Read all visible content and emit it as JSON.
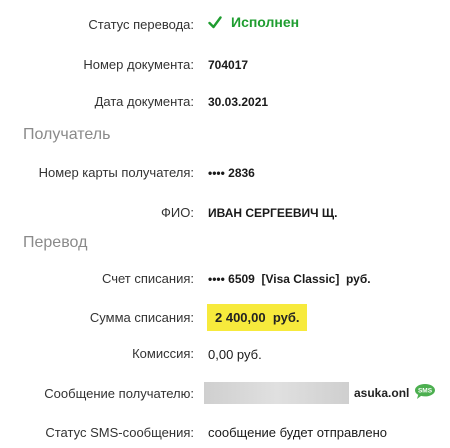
{
  "status": {
    "label": "Статус перевода:",
    "value": "Исполнен",
    "color": "#1f9d30",
    "icon": "checkmark-icon"
  },
  "document_number": {
    "label": "Номер документа:",
    "value": "704017"
  },
  "document_date": {
    "label": "Дата документа:",
    "value": "30.03.2021"
  },
  "recipient_section": {
    "title": "Получатель",
    "card": {
      "label": "Номер карты получателя:",
      "value": "•••• 2836"
    },
    "name": {
      "label": "ФИО:",
      "value": "ИВАН СЕРГЕЕВИЧ Щ."
    }
  },
  "transfer_section": {
    "title": "Перевод",
    "account": {
      "label": "Счет списания:",
      "value": "•••• 6509  [Visa Classic]  руб."
    },
    "amount": {
      "label": "Сумма списания:",
      "value": "2 400,00  руб.",
      "highlight_color": "#f7ea3c"
    },
    "fee": {
      "label": "Комиссия:",
      "value": "0,00 руб."
    },
    "message": {
      "label": "Сообщение получателю:",
      "value_suffix": "asuka.onl",
      "icon": "sms-icon",
      "icon_text": "SMS"
    },
    "sms_status": {
      "label": "Статус SMS-сообщения:",
      "value": "сообщение будет отправлено"
    }
  }
}
